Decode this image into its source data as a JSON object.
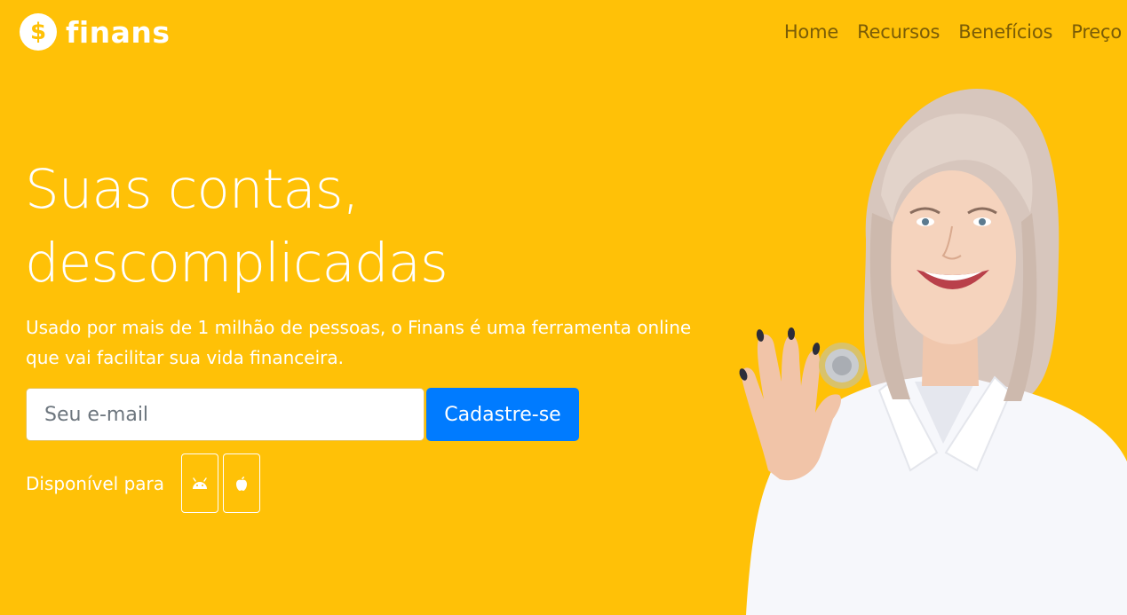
{
  "brand": {
    "name": "finans",
    "icon": "dollar-coin-icon",
    "primary_color": "#ffc107",
    "accent_color": "#007bff"
  },
  "nav": {
    "items": [
      {
        "label": "Home"
      },
      {
        "label": "Recursos"
      },
      {
        "label": "Benefícios"
      },
      {
        "label": "Preço"
      }
    ]
  },
  "hero": {
    "title_line1": "Suas contas,",
    "title_line2": "descomplicadas",
    "subtitle": "Usado por mais de 1 milhão de pessoas, o Finans é uma ferramenta online que vai facilitar sua vida financeira.",
    "email_placeholder": "Seu e-mail",
    "signup_label": "Cadastre-se",
    "available_label": "Disponível para",
    "platforms": [
      {
        "icon": "android-icon"
      },
      {
        "icon": "apple-icon"
      }
    ]
  }
}
